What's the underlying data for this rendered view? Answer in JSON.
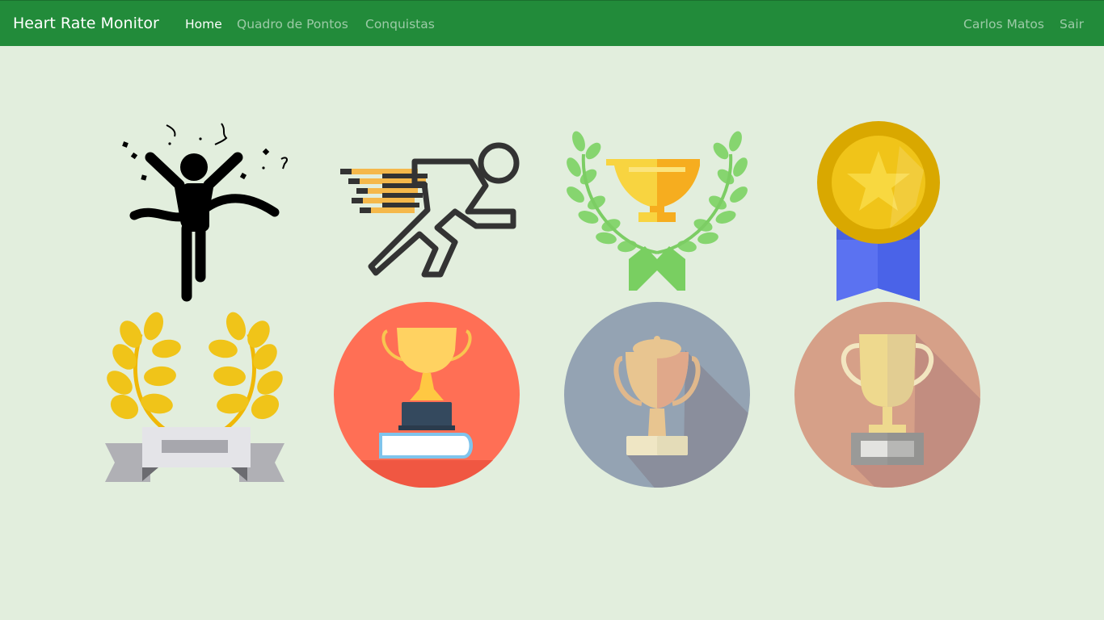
{
  "navbar": {
    "brand": "Heart Rate Monitor",
    "links": [
      {
        "label": "Home",
        "active": true
      },
      {
        "label": "Quadro de Pontos",
        "active": false
      },
      {
        "label": "Conquistas",
        "active": false
      }
    ],
    "user": "Carlos Matos",
    "logout": "Sair"
  },
  "colors": {
    "navbar": "#228b3a",
    "background": "#e2eedd",
    "gold": "#f0c419",
    "coral": "#ff6f55",
    "slate": "#94a3b3",
    "rose": "#d6a088"
  },
  "achievements": [
    {
      "icon": "finish-line-runner-icon"
    },
    {
      "icon": "sprinting-runner-icon"
    },
    {
      "icon": "trophy-laurel-green-icon"
    },
    {
      "icon": "gold-star-medal-icon"
    },
    {
      "icon": "laurel-wreath-banner-icon"
    },
    {
      "icon": "trophy-on-book-icon"
    },
    {
      "icon": "trophy-slate-circle-icon"
    },
    {
      "icon": "trophy-rose-circle-icon"
    }
  ]
}
